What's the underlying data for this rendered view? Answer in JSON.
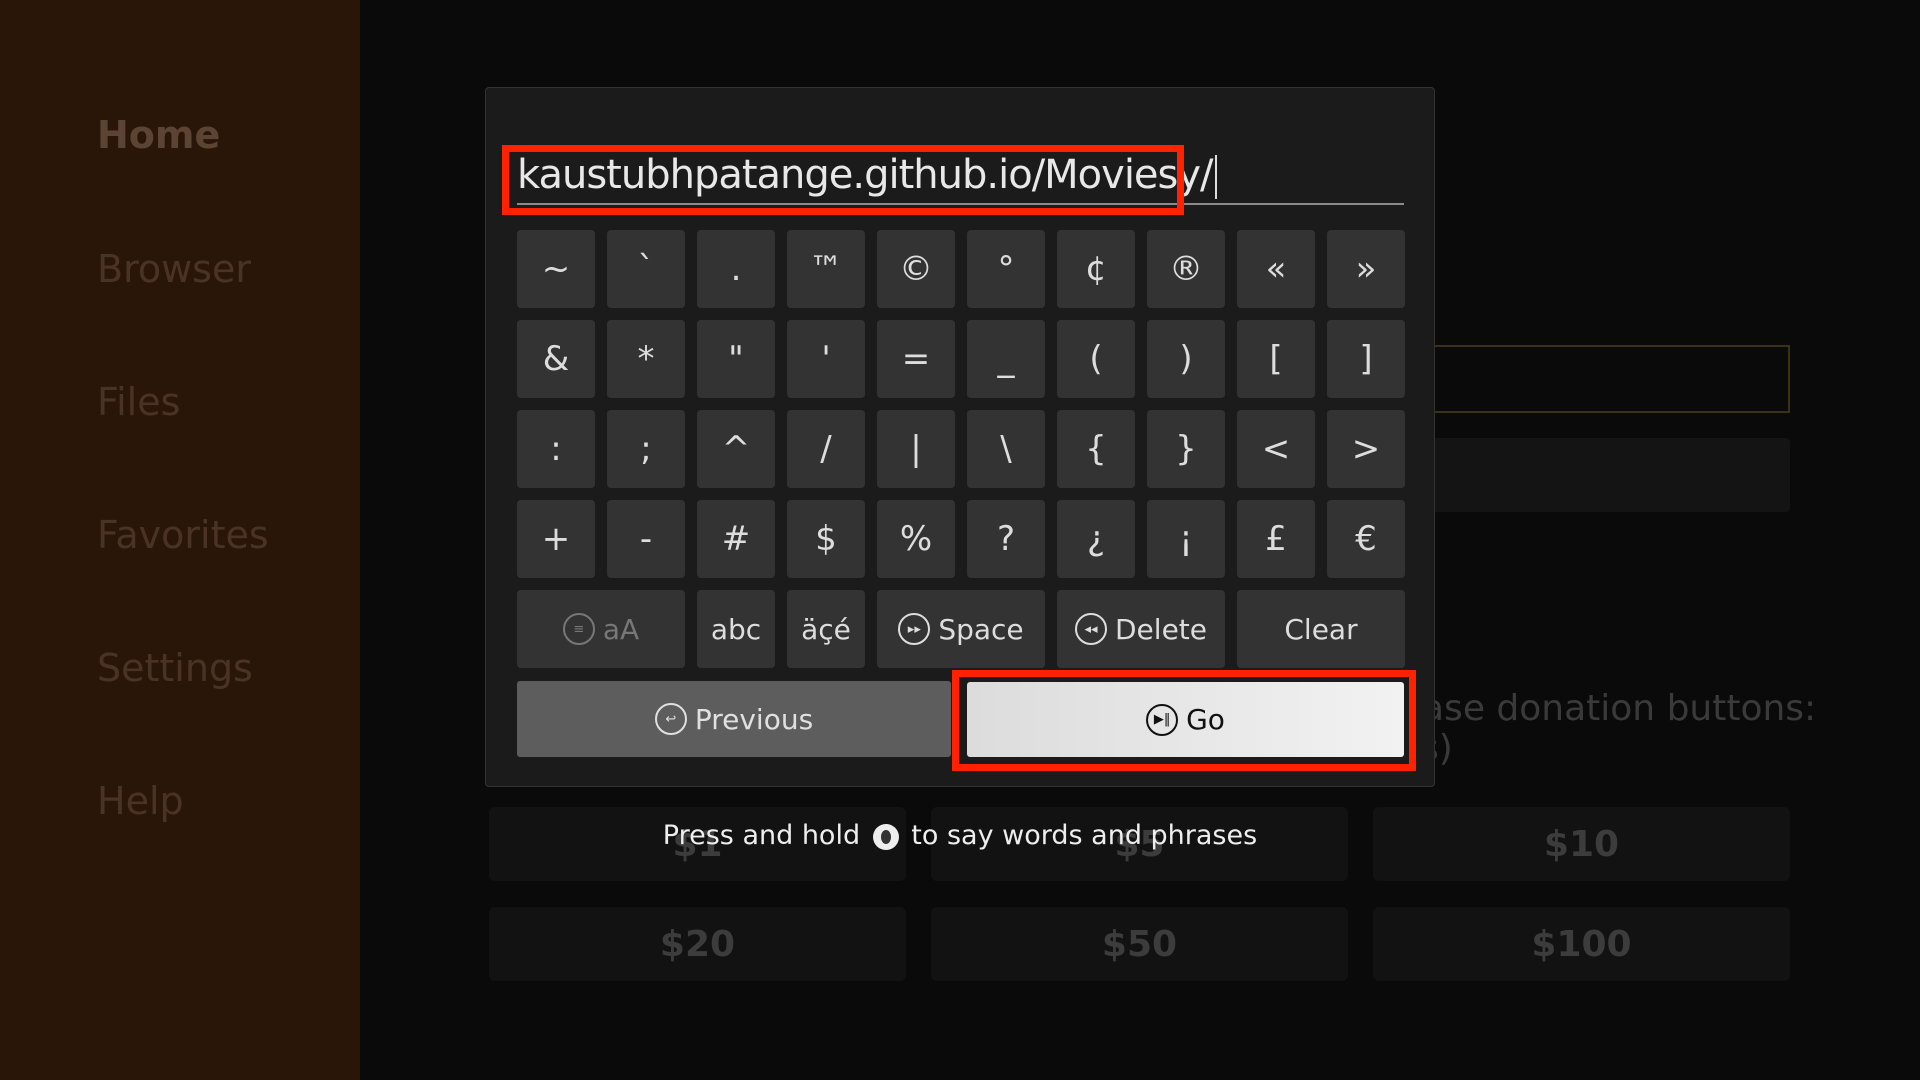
{
  "sidebar": {
    "items": [
      {
        "label": "Home",
        "active": true
      },
      {
        "label": "Browser"
      },
      {
        "label": "Files"
      },
      {
        "label": "Favorites"
      },
      {
        "label": "Settings"
      },
      {
        "label": "Help"
      }
    ]
  },
  "background": {
    "donation_text": "ase donation buttons:",
    "donation_text2": "s)",
    "donations": [
      "$1",
      "$5",
      "$10",
      "$20",
      "$50",
      "$100"
    ]
  },
  "keyboard": {
    "input_value": "kaustubhpatange.github.io/Moviesy/",
    "rows": [
      [
        "~",
        "`",
        ".",
        "™",
        "©",
        "°",
        "¢",
        "®",
        "«",
        "»"
      ],
      [
        "&",
        "*",
        "\"",
        "'",
        "=",
        "_",
        "(",
        ")",
        "[",
        "]"
      ],
      [
        ":",
        ";",
        "^",
        "/",
        "|",
        "\\",
        "{",
        "}",
        "<",
        ">"
      ],
      [
        "+",
        "-",
        "#",
        "$",
        "%",
        "?",
        "¿",
        "¡",
        "£",
        "€"
      ]
    ],
    "function_keys": [
      {
        "label": "aA",
        "icon": "menu-icon"
      },
      {
        "label": "abc"
      },
      {
        "label": "äçé"
      },
      {
        "label": "Space",
        "icon": "fast-forward-icon"
      },
      {
        "label": "Delete",
        "icon": "rewind-icon"
      },
      {
        "label": "Clear"
      }
    ],
    "previous_label": "Previous",
    "go_label": "Go"
  },
  "hint": {
    "before": "Press and hold",
    "after": "to say words and phrases"
  },
  "colors": {
    "highlight": "#ff2200",
    "sidebar": "#2a1609"
  }
}
